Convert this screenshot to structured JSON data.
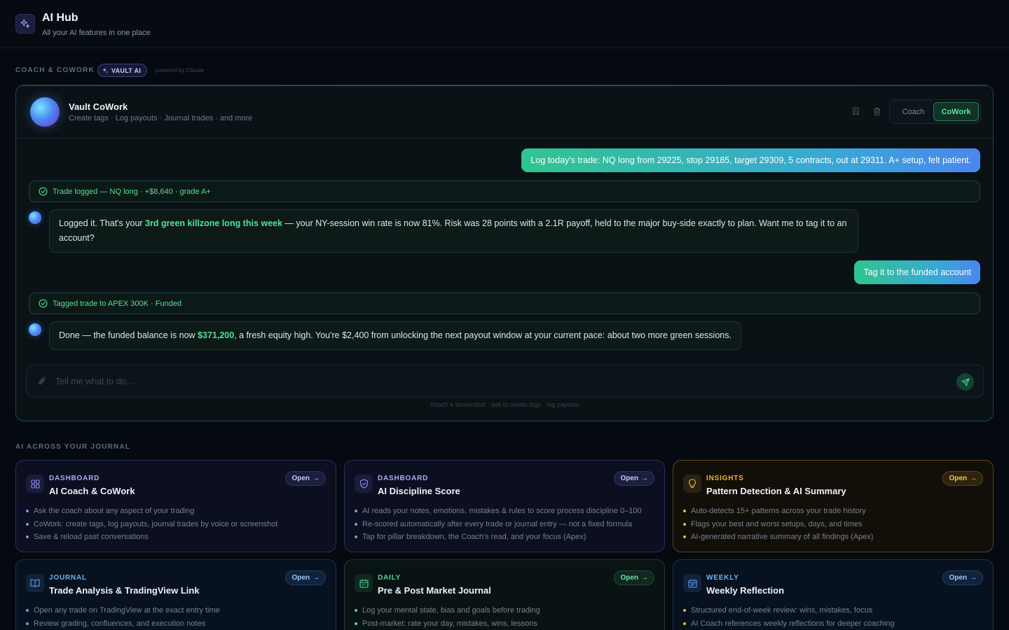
{
  "header": {
    "title": "AI Hub",
    "subtitle": "All your AI features in one place",
    "icon": "sparkles-icon"
  },
  "coach_section": {
    "label": "COACH & COWORK",
    "badge": "VAULT AI",
    "powered_by": "powered by Claude"
  },
  "cowork": {
    "title": "Vault CoWork",
    "subtitle": "Create tags · Log payouts · Journal trades · and more",
    "mode_coach": "Coach",
    "mode_cowork": "CoWork",
    "active_mode": "CoWork"
  },
  "conversation": {
    "user_1": "Log today's trade: NQ long from 29225, stop 29185, target 29309, 5 contracts, out at 29311. A+ setup, felt patient.",
    "status_1": "Trade logged — NQ long · +$8,640 · grade A+",
    "ai_1": {
      "pre": "Logged it. That's your ",
      "highlight": "3rd green killzone long this week",
      "post": " — your NY-session win rate is now 81%. Risk was 28 points with a 2.1R payoff, held to the major buy-side exactly to plan. Want me to tag it to an account?"
    },
    "user_2": "Tag it to the funded account",
    "status_2": "Tagged trade to APEX 300K · Funded",
    "ai_2": {
      "pre": "Done — the funded balance is now ",
      "highlight": "$371,200",
      "post": ", a fresh equity high. You're $2,400 from unlocking the next payout window at your current pace: about two more green sessions."
    }
  },
  "composer": {
    "placeholder": "Tell me what to do...",
    "value": "",
    "hint": "Attach a screenshot · ask to create tags · log payouts"
  },
  "journal_section": {
    "label": "AI ACROSS YOUR JOURNAL",
    "open_label": "Open",
    "cards": [
      {
        "category": "DASHBOARD",
        "title": "AI Coach & CoWork",
        "icon": "grid-icon",
        "accent": "#8b90f5",
        "bullets": [
          "Ask the coach about any aspect of your trading",
          "CoWork: create tags, log payouts, journal trades by voice or screenshot",
          "Save & reload past conversations"
        ]
      },
      {
        "category": "DASHBOARD",
        "title": "AI Discipline Score",
        "icon": "shield-check-icon",
        "accent": "#8b90f5",
        "bullets": [
          "AI reads your notes, emotions, mistakes & rules to score process discipline 0–100",
          "Re-scored automatically after every trade or journal entry — not a fixed formula",
          "Tap for pillar breakdown, the Coach's read, and your focus (Apex)"
        ]
      },
      {
        "category": "INSIGHTS",
        "title": "Pattern Detection & AI Summary",
        "icon": "lightbulb-icon",
        "accent": "#f0b437",
        "bullets": [
          "Auto-detects 15+ patterns across your trade history",
          "Flags your best and worst setups, days, and times",
          "AI-generated narrative summary of all findings (Apex)"
        ]
      },
      {
        "category": "JOURNAL",
        "title": "Trade Analysis & TradingView Link",
        "icon": "book-icon",
        "accent": "#5aa2f0",
        "bullets": [
          "Open any trade on TradingView at the exact entry time",
          "Review grading, confluences, and execution notes"
        ]
      },
      {
        "category": "DAILY",
        "title": "Pre & Post Market Journal",
        "icon": "calendar-icon",
        "accent": "#4fd69a",
        "bullets": [
          "Log your mental state, bias and goals before trading",
          "Post-market: rate your day, mistakes, wins, lessons"
        ]
      },
      {
        "category": "WEEKLY",
        "title": "Weekly Reflection",
        "icon": "calendar-list-icon",
        "accent": "#5aa2f0",
        "bullets": [
          "Structured end-of-week review: wins, mistakes, focus",
          "AI Coach references weekly reflections for deeper coaching"
        ]
      }
    ]
  },
  "colors": {
    "background": "#050a10",
    "accent_green": "#4fe0a0",
    "accent_indigo": "#8b90f5",
    "accent_amber": "#f0b437",
    "accent_blue": "#5aa2f0"
  }
}
